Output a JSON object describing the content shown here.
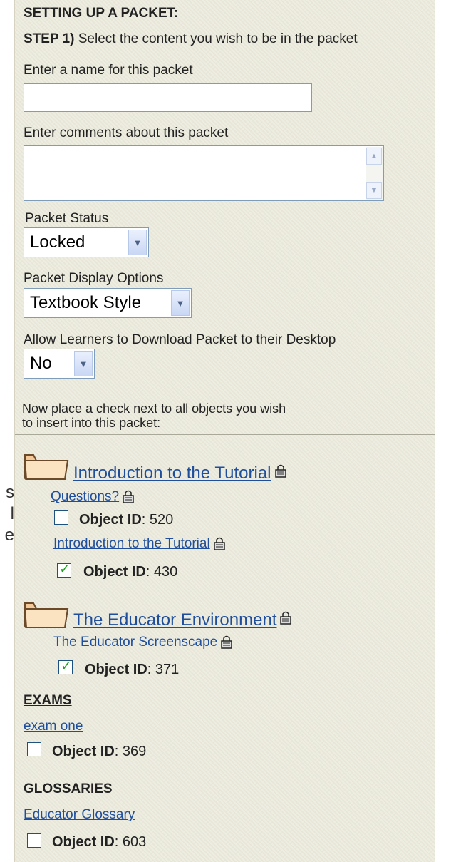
{
  "edge_chars": [
    "s",
    "l",
    "e"
  ],
  "header": {
    "title": "SETTING UP A PACKET:",
    "step_bold": "STEP 1)",
    "step_text": " Select the content you wish to be in the packet"
  },
  "form": {
    "name_label": "Enter a name for this packet",
    "name_value": "",
    "comments_label": "Enter comments about this packet",
    "comments_value": "",
    "status_label": "Packet Status",
    "status_value": "Locked",
    "display_label": "Packet Display Options",
    "display_value": "Textbook Style",
    "download_label": "Allow Learners to Download Packet to their Desktop",
    "download_value": "No"
  },
  "instructions": {
    "line1": "Now place a check next to all  objects you wish",
    "line2": "to insert into this packet:"
  },
  "folders": [
    {
      "title": "Introduction to the Tutorial",
      "items": [
        {
          "title": "Questions?",
          "id_label": "Object ID",
          "id_value": ": 520",
          "checked": false
        },
        {
          "title": "Introduction to the Tutorial",
          "id_label": "Object ID",
          "id_value": ": 430",
          "checked": true
        }
      ]
    },
    {
      "title": "The Educator Environment",
      "items": [
        {
          "title": "The Educator Screenscape",
          "id_label": "Object ID",
          "id_value": ": 371",
          "checked": true
        }
      ]
    }
  ],
  "exams": {
    "heading": "EXAMS",
    "items": [
      {
        "title": "exam one",
        "id_label": "Object ID",
        "id_value": ": 369",
        "checked": false
      }
    ]
  },
  "glossaries": {
    "heading": "GLOSSARIES",
    "items": [
      {
        "title": "Educator Glossary",
        "id_label": "Object ID",
        "id_value": ": 603",
        "checked": false
      }
    ]
  },
  "colors": {
    "panel_bg": "#ecebdd",
    "link": "#1f4e9c",
    "check": "#21a121"
  }
}
